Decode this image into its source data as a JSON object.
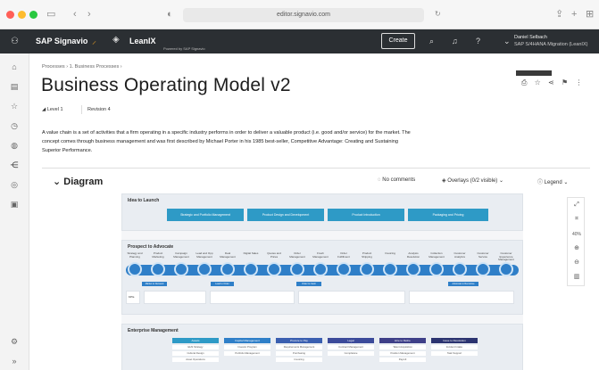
{
  "browser": {
    "url": "editor.signavio.com"
  },
  "header": {
    "brand": "SAP Signavio",
    "partner": "LeanIX",
    "partner_tagline": "Powered by SAP Signavio",
    "create_label": "Create",
    "user_name": "Daniel Selbach",
    "user_workspace": "SAP S/4HANA Migration (LeanIX)"
  },
  "page": {
    "breadcrumb": "Processes  ›  1. Business Processes  ›",
    "title": "Business Operating Model v2",
    "level": "Level 1",
    "revision": "Revision 4",
    "description": "A value chain is a set of activities that a firm operating in a specific industry performs in order to deliver a valuable product (i.e. good and/or service) for the market. The concept comes through business management and was first described by Michael Porter in his 1985 best-seller, Competitive Advantage: Creating and Sustaining Superior Performance."
  },
  "diagram": {
    "title": "Diagram",
    "comments": "No comments",
    "overlays": "Overlays (0/2 visible)",
    "legend": "Legend",
    "zoom_level": "40%",
    "sections": {
      "idea": {
        "title": "Idea to Launch",
        "steps": [
          "Strategic and Portfolio Management",
          "Product Design and Development",
          "Product Introduction",
          "Packaging and Pricing"
        ]
      },
      "prospect": {
        "title": "Prospect to Advocate",
        "steps": [
          "Strategy and Planning",
          "Product Marketing",
          "Campaign Management",
          "Lead and Opp Management",
          "Deal Management",
          "Digital Sales",
          "Quotes and Prices",
          "Order Management",
          "Fresh Management",
          "Order Fulfillment",
          "Product Shipping",
          "Invoicing",
          "Analysis Resolution",
          "Collection Management",
          "Customer Analytics",
          "Customer Service",
          "Customer Experience Management"
        ],
        "tags": [
          "Market to Demand",
          "Lead to Order",
          "Order to Cash",
          "Advocate to Recursive"
        ],
        "row_label": "KPIs"
      },
      "enterprise": {
        "title": "Enterprise Management",
        "columns": [
          {
            "title": "Assets",
            "items": [
              "EHS Strategy",
              "Cultural Design",
              "Asset Operations"
            ]
          },
          {
            "title": "Capital Management",
            "items": [
              "Investor Program",
              "Portfolio Management"
            ]
          },
          {
            "title": "Procure to Pay",
            "items": [
              "Requirements Management",
              "Purchasing",
              "Invoicing"
            ]
          },
          {
            "title": "Legal",
            "items": [
              "Contract Management",
              "Compliance"
            ]
          },
          {
            "title": "Hire to Retire",
            "items": [
              "Talent Acquisition",
              "Position Management",
              "Payroll"
            ]
          },
          {
            "title": "Issue to Resolution",
            "items": [
              "Incident Intake",
              "Task Support"
            ]
          }
        ]
      }
    }
  },
  "colors": {
    "header_bg": "#2b2f33",
    "accent_blue": "#2f7fc8",
    "chevron_blue": "#2e9ac6"
  }
}
